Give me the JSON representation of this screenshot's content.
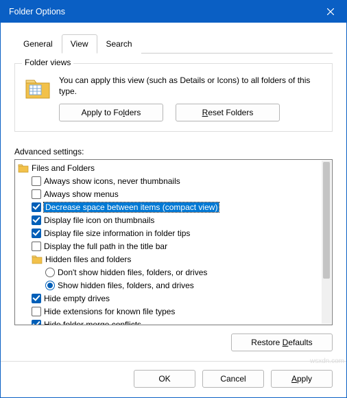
{
  "window": {
    "title": "Folder Options"
  },
  "tabs": [
    {
      "label": "General",
      "active": false
    },
    {
      "label": "View",
      "active": true
    },
    {
      "label": "Search",
      "active": false
    }
  ],
  "folder_views": {
    "legend": "Folder views",
    "description": "You can apply this view (such as Details or Icons) to all folders of this type.",
    "apply_label_pre": "Apply to Fo",
    "apply_label_u": "l",
    "apply_label_post": "ders",
    "reset_label_u": "R",
    "reset_label_post": "eset Folders"
  },
  "advanced_label": "Advanced settings:",
  "tree": {
    "root_label": "Files and Folders",
    "items": [
      {
        "type": "checkbox",
        "checked": false,
        "selected": false,
        "label": "Always show icons, never thumbnails"
      },
      {
        "type": "checkbox",
        "checked": false,
        "selected": false,
        "label": "Always show menus"
      },
      {
        "type": "checkbox",
        "checked": true,
        "selected": true,
        "label": "Decrease space between items (compact view)"
      },
      {
        "type": "checkbox",
        "checked": true,
        "selected": false,
        "label": "Display file icon on thumbnails"
      },
      {
        "type": "checkbox",
        "checked": true,
        "selected": false,
        "label": "Display file size information in folder tips"
      },
      {
        "type": "checkbox",
        "checked": false,
        "selected": false,
        "label": "Display the full path in the title bar"
      },
      {
        "type": "folder",
        "label": "Hidden files and folders"
      },
      {
        "type": "radio",
        "checked": false,
        "selected": false,
        "depth": 2,
        "label": "Don't show hidden files, folders, or drives"
      },
      {
        "type": "radio",
        "checked": true,
        "selected": false,
        "depth": 2,
        "label": "Show hidden files, folders, and drives"
      },
      {
        "type": "checkbox",
        "checked": true,
        "selected": false,
        "label": "Hide empty drives"
      },
      {
        "type": "checkbox",
        "checked": false,
        "selected": false,
        "label": "Hide extensions for known file types"
      },
      {
        "type": "checkbox",
        "checked": true,
        "selected": false,
        "label": "Hide folder merge conflicts"
      }
    ]
  },
  "restore_defaults_pre": "Restore ",
  "restore_defaults_u": "D",
  "restore_defaults_post": "efaults",
  "footer": {
    "ok": "OK",
    "cancel": "Cancel",
    "apply_u": "A",
    "apply_post": "pply"
  },
  "watermark": "wsxdn.com"
}
